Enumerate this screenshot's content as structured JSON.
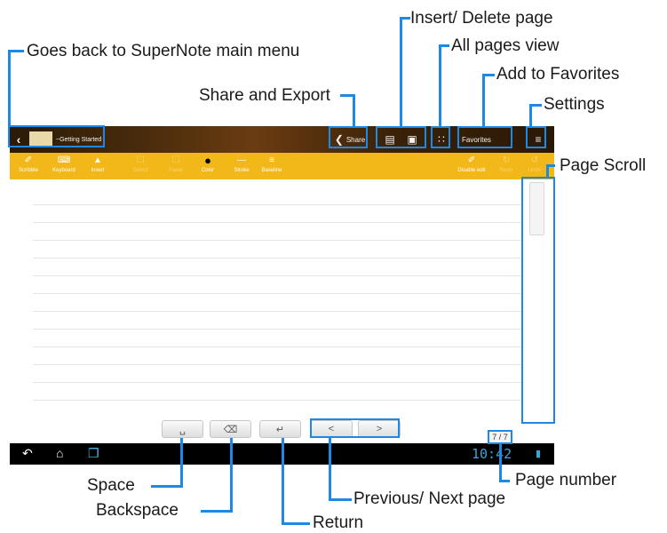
{
  "callouts": {
    "back": "Goes back to SuperNote main menu",
    "share_export": "Share and Export",
    "insert_delete": "Insert/ Delete page",
    "all_pages": "All pages view",
    "favorites": "Add to Favorites",
    "settings": "Settings",
    "page_scroll": "Page Scroll",
    "page_number": "Page number",
    "space": "Space",
    "backspace": "Backspace",
    "return": "Return",
    "prev_next": "Previous/ Next page"
  },
  "appbar": {
    "notebook_title": "~Getting Started",
    "share_label": "Share",
    "favorites_label": "Favorites"
  },
  "toolbar": {
    "scribble": "Scribble",
    "keyboard": "Keyboard",
    "insert": "Insert",
    "select": "Select",
    "paste": "Paste",
    "color": "Color",
    "stroke": "Stroke",
    "baseline": "Baseline",
    "disable_edit": "Disable edit",
    "redo": "Redo",
    "undo": "Undo"
  },
  "page_indicator": "7 / 7",
  "keys": {
    "prev": "<",
    "next": ">"
  },
  "clock": "10:42",
  "colors": {
    "callout_blue": "#1e88e5",
    "toolbar_yellow": "#f2b718"
  }
}
